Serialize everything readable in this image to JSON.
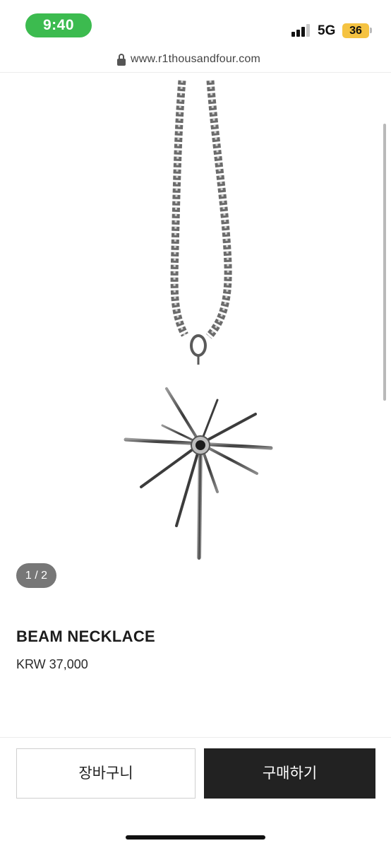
{
  "status_bar": {
    "time": "9:40",
    "network": "5G",
    "battery": "36",
    "signal_bars": 3,
    "signal_max": 4
  },
  "browser": {
    "url": "www.r1thousandfour.com",
    "lock_icon": "lock-icon"
  },
  "gallery": {
    "indicator": "1 / 2",
    "image_description_icon": "star-pendant-necklace-image"
  },
  "product": {
    "name": "BEAM NECKLACE",
    "price": "KRW 37,000"
  },
  "actions": {
    "cart_label": "장바구니",
    "buy_label": "구매하기"
  },
  "colors": {
    "time_pill": "#3cbb4f",
    "battery": "#f5c342",
    "buy_button": "#222222"
  }
}
